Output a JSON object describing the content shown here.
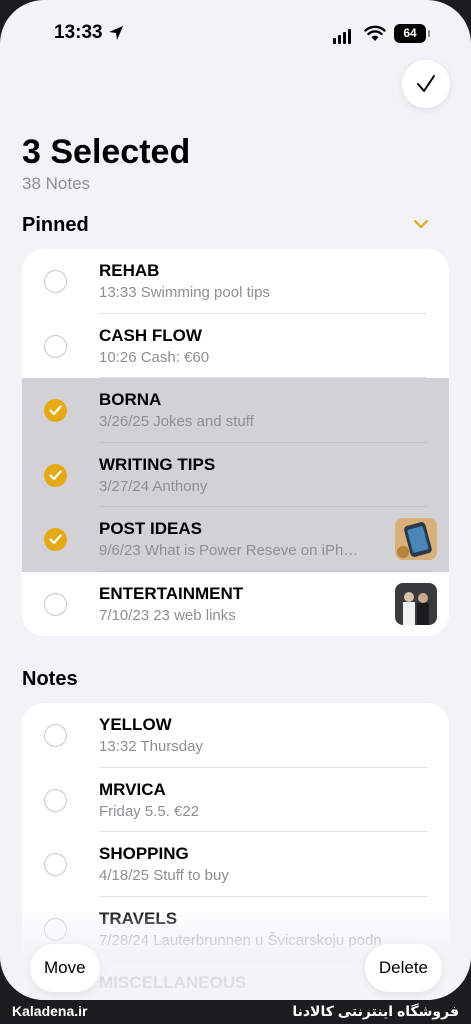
{
  "status_bar": {
    "time": "13:33",
    "battery": "64"
  },
  "header": {
    "title": "3 Selected",
    "subtitle": "38 Notes"
  },
  "pinned": {
    "label": "Pinned",
    "rows": [
      {
        "title": "REHAB",
        "sub": "13:33  Swimming pool tips",
        "selected": false
      },
      {
        "title": "CASH FLOW",
        "sub": "10:26  Cash: €60",
        "selected": false
      },
      {
        "title": "BORNA",
        "sub": "3/26/25  Jokes and stuff",
        "selected": true
      },
      {
        "title": "WRITING TIPS",
        "sub": "3/27/24  Anthony",
        "selected": true
      },
      {
        "title": "POST IDEAS",
        "sub": "9/6/23  What is Power Reseve on iPh…",
        "selected": true,
        "thumb": "phone-photo-thumbnail"
      },
      {
        "title": "ENTERTAINMENT",
        "sub": "7/10/23  23 web links",
        "selected": false,
        "thumb": "people-photo-thumbnail"
      }
    ]
  },
  "notes": {
    "label": "Notes",
    "rows": [
      {
        "title": "YELLOW",
        "sub": "13:32  Thursday",
        "selected": false
      },
      {
        "title": "MRVICA",
        "sub": "Friday  5.5. €22",
        "selected": false
      },
      {
        "title": "SHOPPING",
        "sub": "4/18/25  Stuff to buy",
        "selected": false
      },
      {
        "title": "TRAVELS",
        "sub": "7/28/24  Lauterbrunnen u Švicarskoju podn",
        "selected": false
      },
      {
        "title": "MISCELLANEOUS",
        "sub": "",
        "selected": false
      }
    ]
  },
  "toolbar": {
    "move_label": "Move",
    "delete_label": "Delete"
  },
  "watermark": {
    "left": "Kaladena.ir",
    "right": "فروشگاه اینترنتی کالادنا"
  },
  "colors": {
    "accent": "#e6a916",
    "background": "#f2f2f7",
    "selected_row": "#d1d1d6"
  }
}
